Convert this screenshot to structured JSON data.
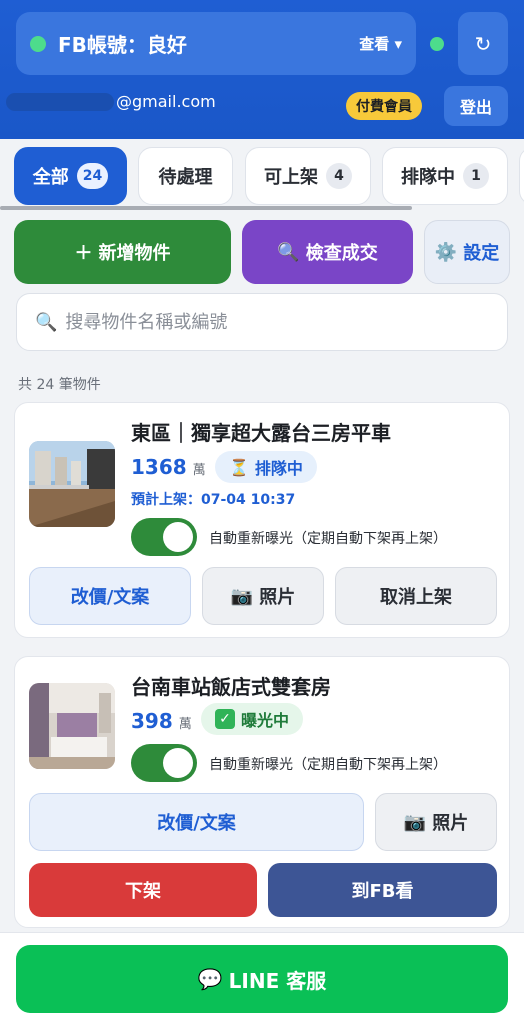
{
  "header": {
    "account_title": "FB帳號：良好",
    "view_label": "查看 ▾",
    "refresh_glyph": "↻",
    "email": "@gmail.com",
    "paid_badge": "付費會員",
    "logout_label": "登出",
    "status_color": "#4ddc8c"
  },
  "tabs": [
    {
      "label": "全部",
      "count": "24",
      "active": true
    },
    {
      "label": "待處理",
      "count": ""
    },
    {
      "label": "可上架",
      "count": "4"
    },
    {
      "label": "排隊中",
      "count": "1"
    }
  ],
  "actions": {
    "add_label": "新增物件",
    "add_icon": "plus-icon",
    "check_label": "檢查成交",
    "check_icon": "magnifier-icon",
    "settings_label": "設定",
    "settings_icon": "gear-icon"
  },
  "search": {
    "placeholder": "搜尋物件名稱或編號"
  },
  "list_count": "共 24 筆物件",
  "listings": [
    {
      "title": "東區｜獨享超大露台三房平車",
      "price": "1368",
      "unit": "萬",
      "status": "排隊中",
      "status_icon": "hourglass-icon",
      "schedule": "預計上架：07-04 10:37",
      "auto_label": "自動重新曝光（定期自動下架再上架）",
      "auto_on": true,
      "buttons": [
        "改價/文案",
        "照片",
        "取消上架"
      ]
    },
    {
      "title": "台南車站飯店式雙套房",
      "price": "398",
      "unit": "萬",
      "status": "曝光中",
      "status_icon": "check-icon",
      "auto_label": "自動重新曝光（定期自動下架再上架）",
      "auto_on": true,
      "buttons": [
        "改價/文案",
        "照片",
        "下架",
        "到FB看"
      ]
    }
  ],
  "bottom": {
    "line_label": "LINE 客服",
    "line_icon": "chat-bubble-icon"
  },
  "colors": {
    "brand": "#1f5ed3",
    "green": "#2e8b3a",
    "purple": "#7a45c7",
    "line_green": "#0ac056",
    "red": "#d93a3a",
    "navy": "#3d5595"
  }
}
